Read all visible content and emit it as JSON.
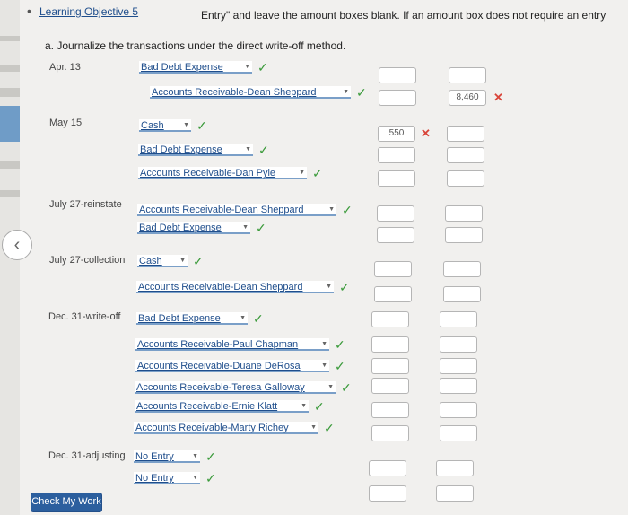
{
  "header": {
    "bullet": "•",
    "learning_objective": "Learning Objective 5",
    "instruction": "Entry\" and leave the amount boxes blank. If an amount box does not require an entry"
  },
  "part_a": {
    "label": "a. Journalize the transactions under the direct write-off method."
  },
  "icons": {
    "check": "✓",
    "x": "✕",
    "dropdown": "▼",
    "nav_prev": "‹"
  },
  "entries": [
    {
      "date": "Apr. 13",
      "lines": [
        {
          "account": "Bad Debt Expense",
          "status": "check",
          "debit": "",
          "credit": ""
        },
        {
          "account": "Accounts Receivable-Dean Sheppard",
          "status": "check",
          "debit": "",
          "credit": "8,460",
          "credit_status": "x"
        }
      ]
    },
    {
      "date": "May 15",
      "lines": [
        {
          "account": "Cash",
          "status": "check",
          "debit": "550",
          "debit_status": "x",
          "credit": ""
        },
        {
          "account": "Bad Debt Expense",
          "status": "check",
          "debit": "",
          "credit": ""
        },
        {
          "account": "Accounts Receivable-Dan Pyle",
          "status": "check",
          "debit": "",
          "credit": ""
        }
      ]
    },
    {
      "date": "July 27-reinstate",
      "lines": [
        {
          "account": "Accounts Receivable-Dean Sheppard",
          "status": "check",
          "debit": "",
          "credit": ""
        },
        {
          "account": "Bad Debt Expense",
          "status": "check",
          "debit": "",
          "credit": ""
        }
      ]
    },
    {
      "date": "July 27-collection",
      "lines": [
        {
          "account": "Cash",
          "status": "check",
          "debit": "",
          "credit": ""
        },
        {
          "account": "Accounts Receivable-Dean Sheppard",
          "status": "check",
          "debit": "",
          "credit": ""
        }
      ]
    },
    {
      "date": "Dec. 31-write-off",
      "lines": [
        {
          "account": "Bad Debt Expense",
          "status": "check",
          "debit": "",
          "credit": ""
        },
        {
          "account": "Accounts Receivable-Paul Chapman",
          "status": "check",
          "debit": "",
          "credit": ""
        },
        {
          "account": "Accounts Receivable-Duane DeRosa",
          "status": "check",
          "debit": "",
          "credit": ""
        },
        {
          "account": "Accounts Receivable-Teresa Galloway",
          "status": "check",
          "debit": "",
          "credit": ""
        },
        {
          "account": "Accounts Receivable-Ernie Klatt",
          "status": "check",
          "debit": "",
          "credit": ""
        },
        {
          "account": "Accounts Receivable-Marty Richey",
          "status": "check",
          "debit": "",
          "credit": ""
        }
      ]
    },
    {
      "date": "Dec. 31-adjusting",
      "lines": [
        {
          "account": "No Entry",
          "status": "check",
          "debit": "",
          "credit": ""
        },
        {
          "account": "No Entry",
          "status": "check",
          "debit": "",
          "credit": ""
        }
      ]
    }
  ],
  "footer": {
    "check_button": "Check My Work"
  }
}
